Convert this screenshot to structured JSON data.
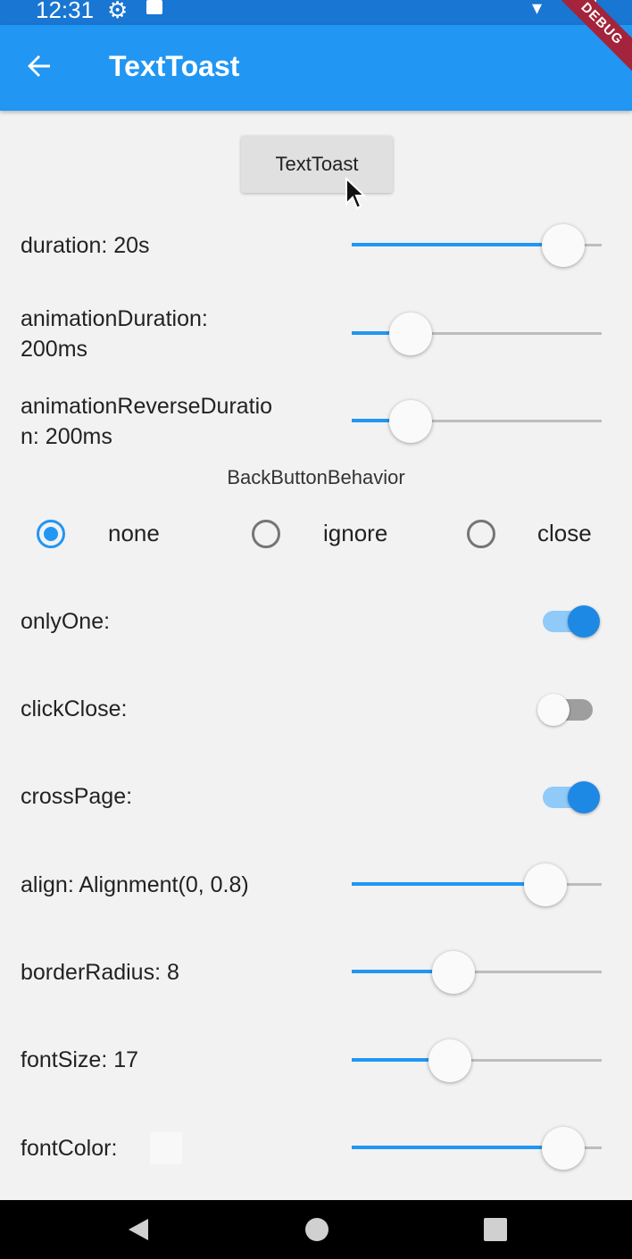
{
  "status_bar": {
    "time": "12:31"
  },
  "debug_banner": "DEBUG",
  "app_bar": {
    "title": "TextToast"
  },
  "toast_button": {
    "label": "TextToast"
  },
  "settings": {
    "duration": {
      "label": "duration:   20s",
      "value_fraction": 0.92
    },
    "animation_duration": {
      "label": "animationDuration:\n200ms",
      "value_fraction": 0.18
    },
    "animation_reverse_duration": {
      "label": "animationReverseDuratio\nn:   200ms",
      "value_fraction": 0.18
    },
    "back_button_behavior": {
      "title": "BackButtonBehavior",
      "options": [
        "none",
        "ignore",
        "close"
      ],
      "selected": "none"
    },
    "only_one": {
      "label": "onlyOne:",
      "on": true
    },
    "click_close": {
      "label": "clickClose:",
      "on": false
    },
    "cross_page": {
      "label": "crossPage:",
      "on": true
    },
    "align": {
      "label": "align:  Alignment(0, 0.8)",
      "value_fraction": 0.83
    },
    "border_radius": {
      "label": "borderRadius:  8",
      "value_fraction": 0.39
    },
    "font_size": {
      "label": "fontSize:  17",
      "value_fraction": 0.37
    },
    "font_color": {
      "label": "fontColor:",
      "swatch_color": "#f8f8f8",
      "value_fraction": 0.92
    }
  },
  "colors": {
    "primary": "#2196f3",
    "app_bar": "#2196f3",
    "status_bar": "#1976d2",
    "switch_on": "#1e88e5"
  },
  "icons": {
    "back": "arrow-back-icon",
    "settings": "gear-icon",
    "nav_back": "triangle-back-icon",
    "nav_home": "circle-home-icon",
    "nav_recent": "square-recent-icon"
  }
}
